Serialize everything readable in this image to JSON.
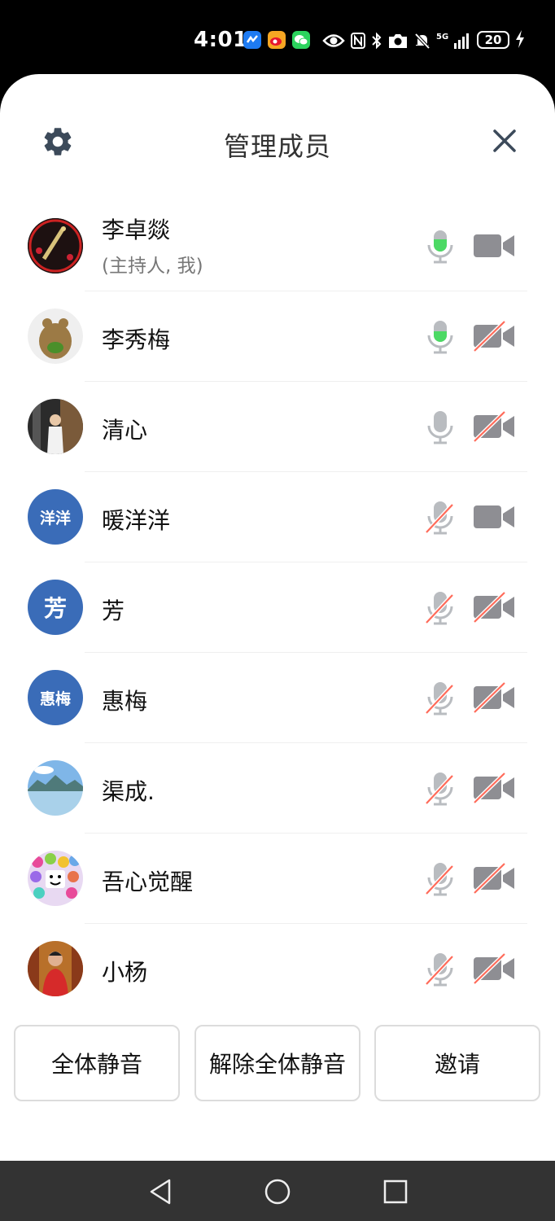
{
  "status_bar": {
    "time": "4:01",
    "network": "5G",
    "battery": "20",
    "app_icons": [
      "maps-app-icon",
      "weibo-app-icon",
      "wechat-app-icon"
    ],
    "system_icons": [
      "eye-icon",
      "nfc-icon",
      "bluetooth-icon",
      "camera-icon",
      "mute-icon",
      "signal-icon"
    ]
  },
  "header": {
    "title": "管理成员",
    "settings_icon": "gear-icon",
    "close_icon": "close-icon"
  },
  "members": [
    {
      "name": "李卓燚",
      "role": "(主持人, 我)",
      "avatar": "photo",
      "mic": "active",
      "camera": "on"
    },
    {
      "name": "李秀梅",
      "role": "",
      "avatar": "photo",
      "mic": "active",
      "camera": "off"
    },
    {
      "name": "清心",
      "role": "",
      "avatar": "photo",
      "mic": "on",
      "camera": "off"
    },
    {
      "name": "暖洋洋",
      "role": "",
      "avatar": "洋洋",
      "mic": "muted",
      "camera": "on"
    },
    {
      "name": "芳",
      "role": "",
      "avatar": "芳",
      "mic": "muted",
      "camera": "off"
    },
    {
      "name": "惠梅",
      "role": "",
      "avatar": "惠梅",
      "mic": "muted",
      "camera": "off"
    },
    {
      "name": "渠成.",
      "role": "",
      "avatar": "photo",
      "mic": "muted",
      "camera": "off"
    },
    {
      "name": "吾心觉醒",
      "role": "",
      "avatar": "photo",
      "mic": "muted",
      "camera": "off"
    },
    {
      "name": "小杨",
      "role": "",
      "avatar": "photo",
      "mic": "muted",
      "camera": "off"
    }
  ],
  "actions": {
    "mute_all": "全体静音",
    "unmute_all": "解除全体静音",
    "invite": "邀请"
  },
  "colors": {
    "accent_green": "#4cd964",
    "avatar_blue": "#3a6cb8",
    "muted_red": "#ff6b5a",
    "icon_gray": "#8e8e93"
  },
  "nav_icons": [
    "back-icon",
    "home-icon",
    "recents-icon"
  ]
}
